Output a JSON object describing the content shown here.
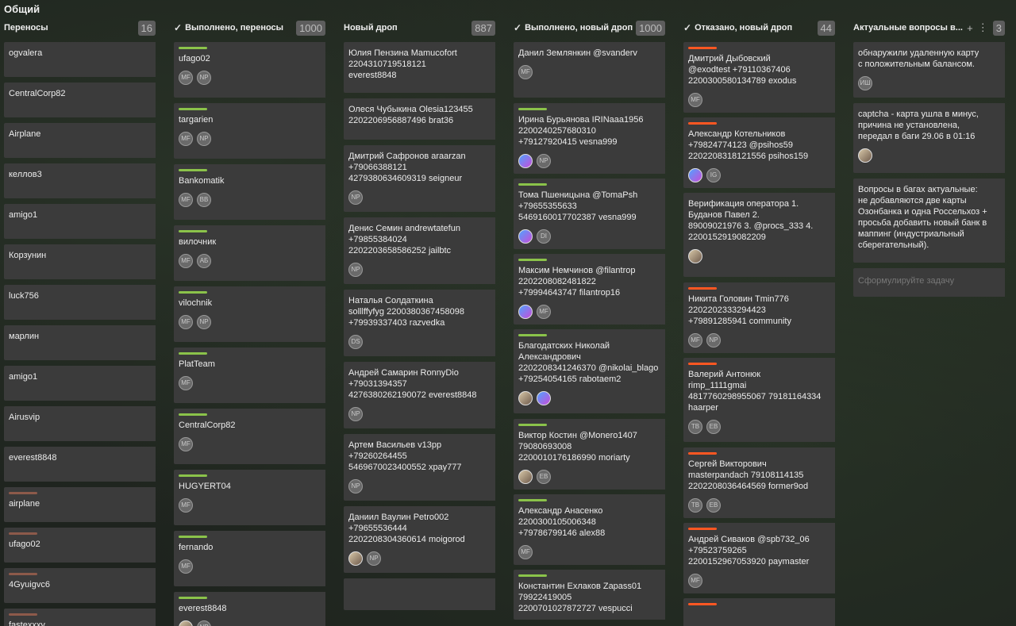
{
  "board": {
    "title": "Общий"
  },
  "columns": [
    {
      "title": "Переносы",
      "count": "16",
      "check": false,
      "cards": [
        {
          "text": "ogvalera"
        },
        {
          "text": "CentralCorp82"
        },
        {
          "text": "Airplane"
        },
        {
          "text": "келлов3"
        },
        {
          "text": "amigo1"
        },
        {
          "text": "Корзунин"
        },
        {
          "text": "luck756"
        },
        {
          "text": "марлин"
        },
        {
          "text": "amigo1"
        },
        {
          "text": "Airusvip"
        },
        {
          "text": "everest8848"
        },
        {
          "text": "airplane",
          "bar": "brown"
        },
        {
          "text": "ufago02",
          "bar": "brown"
        },
        {
          "text": "4Gyuigvc6",
          "bar": "brown"
        },
        {
          "text": "fastexxxy",
          "bar": "brown"
        }
      ]
    },
    {
      "title": "Выполнено, переносы",
      "count": "1000",
      "check": true,
      "cards": [
        {
          "text": "ufago02",
          "bar": "green",
          "avatars": [
            "МF",
            "NP"
          ]
        },
        {
          "text": "targarien",
          "bar": "green",
          "avatars": [
            "МF",
            "NP"
          ]
        },
        {
          "text": "Bankomatik",
          "bar": "green",
          "avatars": [
            "МF",
            "BB"
          ]
        },
        {
          "text": "вилочник",
          "bar": "green",
          "avatars": [
            "МF",
            "АБ"
          ]
        },
        {
          "text": "vilochnik",
          "bar": "green",
          "avatars": [
            "МF",
            "NP"
          ]
        },
        {
          "text": "PlatTeam",
          "bar": "green",
          "avatars": [
            "МF"
          ]
        },
        {
          "text": "CentralCorp82",
          "bar": "green",
          "avatars": [
            "МF"
          ]
        },
        {
          "text": "HUGYERT04",
          "bar": "green",
          "avatars": [
            "МF"
          ]
        },
        {
          "text": "fernando",
          "bar": "green",
          "avatars": [
            "МF"
          ]
        },
        {
          "text": "everest8848",
          "bar": "green",
          "avatars": [
            "img2",
            "NP"
          ]
        }
      ]
    },
    {
      "title": "Новый дроп",
      "count": "887",
      "check": false,
      "cards": [
        {
          "text": "Юлия Пензина Mamucofort\n2204310719518121\neverest8848"
        },
        {
          "text": "Олеся Чубыкина Olesia123455\n2202206956887496 brat36"
        },
        {
          "text": "Дмитрий Сафронов araarzan\n+79066388121\n4279380634609319 seigneur",
          "avatars": [
            "NP"
          ]
        },
        {
          "text": "Денис Семин andrewtatefun\n+79855384024\n2202203658586252 jailbtc",
          "avatars": [
            "NP"
          ]
        },
        {
          "text": "Наталья Солдаткина\nsolllffyfyg 2200380367458098\n+79939337403 razvedka",
          "avatars": [
            "DS"
          ]
        },
        {
          "text": "Андрей Самарин RonnyDio\n+79031394357\n4276380262190072 everest8848",
          "avatars": [
            "NP"
          ]
        },
        {
          "text": "Артем Васильев v13pp\n+79260264455\n5469670023400552 xpay777",
          "avatars": [
            "NP"
          ]
        },
        {
          "text": "Даниил Ваулин Petro002\n+79655536444\n2202208304360614 moigorod",
          "avatars": [
            "img2",
            "NP"
          ]
        },
        {
          "text": ""
        }
      ]
    },
    {
      "title": "Выполнено, новый дроп",
      "count": "1000",
      "check": true,
      "cards": [
        {
          "text": "Данил Землянкин @svanderv",
          "avatars": [
            "МF"
          ]
        },
        {
          "text": "Ирина Бурьянова IRINaaa1956\n2200240257680310\n+79127920415 vesna999",
          "bar": "green",
          "avatars": [
            "img",
            "NP"
          ]
        },
        {
          "text": "Тома Пшеницына @TomaPsh\n+79655355633\n5469160017702387 vesna999",
          "bar": "green",
          "avatars": [
            "img",
            "DI"
          ]
        },
        {
          "text": "Максим Немчинов @filantrop\n2202208082481822\n+79994643747 filantrop16",
          "bar": "green",
          "avatars": [
            "img",
            "МF"
          ]
        },
        {
          "text": "Благодатских Николай\nАлександрович\n2202208341246370 @nikolai_blago\n+79254054165 rabotaem2",
          "bar": "green",
          "avatars": [
            "img2",
            "img"
          ]
        },
        {
          "text": "Виктор Костин @Monero1407\n79080693008\n2200010176186990 moriarty",
          "bar": "green",
          "avatars": [
            "img2",
            "EB"
          ]
        },
        {
          "text": "Александр Анасенко\n2200300105006348\n+79786799146 alex88",
          "bar": "green",
          "avatars": [
            "МF"
          ]
        },
        {
          "text": "Константин Ехлаков Zapass01\n79922419005\n2200701027872727 vespucci",
          "bar": "green"
        }
      ]
    },
    {
      "title": "Отказано, новый дроп",
      "count": "44",
      "check": true,
      "cards": [
        {
          "text": "Дмитрий Дыбовский\n@exodtest +79110367406\n2200300580134789 exodus",
          "bar": "orange",
          "avatars": [
            "МF"
          ]
        },
        {
          "text": "Александр Котельников\n+79824774123 @psihos59\n2202208318121556 psihos159",
          "bar": "orange",
          "avatars": [
            "img",
            "IG"
          ]
        },
        {
          "text": "Верификация оператора 1.\nБуданов Павел 2.\n89009021976 3. @procs_333 4.\n2200152919082209",
          "avatars": [
            "img2"
          ]
        },
        {
          "text": "Никита Головин Tmin776\n2202202333294423\n+79891285941 community",
          "bar": "orange",
          "avatars": [
            "МF",
            "NP"
          ]
        },
        {
          "text": "Валерий Антонюк\nrimp_1111gmai\n4817760298955067 79181164334\nhaarper",
          "bar": "orange",
          "avatars": [
            "TB",
            "EB"
          ]
        },
        {
          "text": "Сергей Викторович\nmasterpandach 79108114135\n2202208036464569 former9od",
          "bar": "orange",
          "avatars": [
            "TB",
            "EB"
          ]
        },
        {
          "text": "Андрей Сиваков @spb732_06\n+79523759265\n2200152967053920 paymaster",
          "bar": "orange",
          "avatars": [
            "МF"
          ]
        },
        {
          "text": "",
          "bar": "orange"
        }
      ]
    },
    {
      "title": "Актуальные вопросы в...",
      "count": "3",
      "check": false,
      "icons": true,
      "cards": [
        {
          "text": "обнаружили удаленную карту\nс положительным балансом.",
          "avatars": [
            "ИШ"
          ]
        },
        {
          "text": "captcha - карта ушла в минус,\nпричина не установлена,\nпередал в баги 29.06 в 01:16",
          "avatars": [
            "img2"
          ]
        },
        {
          "text": "Вопросы в багах актуальные:\nне добавляются две карты\nОзонбанка и одна Россельхоз +\nпросьба добавить новый банк в\nмаппинг (индустриальный\nсберегательный)."
        }
      ],
      "placeholder": "Сформулируйте задачу"
    }
  ],
  "icons": {
    "add": "plus-icon",
    "more": "more-vertical-icon",
    "done": "check-icon"
  }
}
